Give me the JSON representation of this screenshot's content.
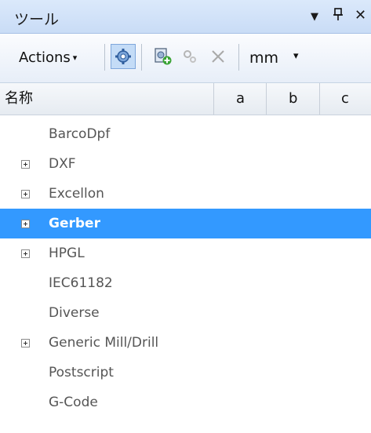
{
  "window": {
    "title": "ツール",
    "dropdown_glyph": "▼",
    "pin_glyph": "ᵖ",
    "close_glyph": "✕"
  },
  "toolbar": {
    "actions_label": "Actions",
    "actions_caret": "▾",
    "unit_value": "mm",
    "unit_caret": "▾",
    "icons": [
      "settings-gear-icon",
      "add-item-icon",
      "gear-small-icon",
      "delete-x-icon"
    ]
  },
  "columns": {
    "name": "名称",
    "a": "a",
    "b": "b",
    "c": "c"
  },
  "tree": {
    "items": [
      {
        "label": "BarcoDpf",
        "expandable": false
      },
      {
        "label": "DXF",
        "expandable": true
      },
      {
        "label": "Excellon",
        "expandable": true
      },
      {
        "label": "Gerber",
        "expandable": true,
        "selected": true
      },
      {
        "label": "HPGL",
        "expandable": true
      },
      {
        "label": "IEC61182",
        "expandable": false
      },
      {
        "label": "Diverse",
        "expandable": false
      },
      {
        "label": "Generic Mill/Drill",
        "expandable": true
      },
      {
        "label": "Postscript",
        "expandable": false
      },
      {
        "label": "G-Code",
        "expandable": false
      }
    ]
  },
  "colors": {
    "selection": "#3399ff",
    "titlebar": "#c9dcf6"
  }
}
